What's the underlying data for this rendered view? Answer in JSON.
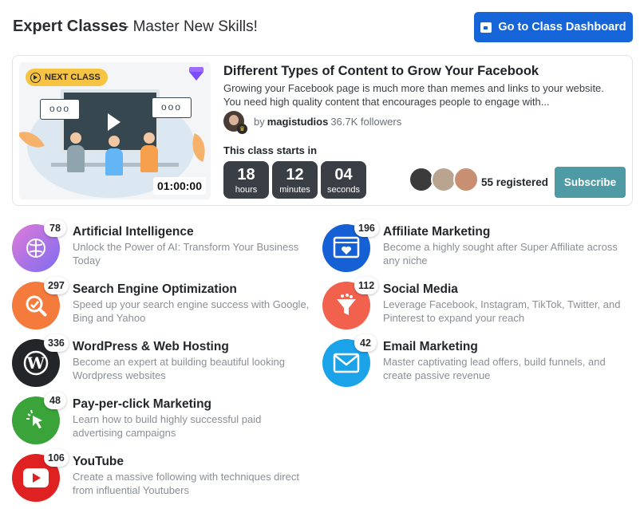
{
  "header": {
    "title": "Expert Classes",
    "subtitle": "- Master New Skills!",
    "dashboard_button": "Go to Class Dashboard"
  },
  "featured": {
    "badge": "NEXT CLASS",
    "duration": "01:00:00",
    "bubble_text": "ooo",
    "title": "Different Types of Content to Grow Your Facebook",
    "description": "Growing your Facebook page is much more than memes and links to your website. You need high quality content that encourages people to engage with...",
    "by": "by",
    "author": "magistudios",
    "followers": "36.7K followers",
    "starts_label": "This class starts in",
    "countdown": [
      {
        "value": "18",
        "label": "hours"
      },
      {
        "value": "12",
        "label": "minutes"
      },
      {
        "value": "04",
        "label": "seconds"
      }
    ],
    "registered": "55 registered",
    "subscribe": "Subscribe"
  },
  "categories": [
    {
      "title": "Artificial Intelligence",
      "description": "Unlock the Power of AI: Transform Your Business Today",
      "count": "78",
      "icon": "brain-icon",
      "color": "#a66de0"
    },
    {
      "title": "Search Engine Optimization",
      "description": "Speed up your search engine success with Google, Bing and Yahoo",
      "count": "297",
      "icon": "seo-magnifier-icon",
      "color": "#f47b3c"
    },
    {
      "title": "WordPress & Web Hosting",
      "description": "Become an expert at building beautiful looking Wordpress websites",
      "count": "336",
      "icon": "wordpress-icon",
      "color": "#222628"
    },
    {
      "title": "Pay-per-click Marketing",
      "description": "Learn how to build highly successful paid advertising campaigns",
      "count": "48",
      "icon": "cursor-click-icon",
      "color": "#3aa43a"
    },
    {
      "title": "YouTube",
      "description": "Create a massive following with techniques direct from influential Youtubers",
      "count": "106",
      "icon": "youtube-icon",
      "color": "#e02121"
    },
    {
      "title": "Affiliate Marketing",
      "description": "Become a highly sought after Super Affiliate across any niche",
      "count": "196",
      "icon": "affiliate-heart-icon",
      "color": "#1560d4"
    },
    {
      "title": "Social Media",
      "description": "Leverage Facebook, Instagram, TikTok, Twitter, and Pinterest to expand your reach",
      "count": "112",
      "icon": "funnel-icon",
      "color": "#f2614d"
    },
    {
      "title": "Email Marketing",
      "description": "Master captivating lead offers, build funnels, and create passive revenue",
      "count": "42",
      "icon": "envelope-icon",
      "color": "#1aa3e8"
    }
  ]
}
